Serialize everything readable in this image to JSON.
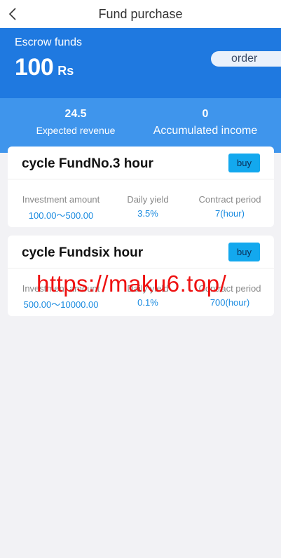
{
  "header": {
    "title": "Fund purchase"
  },
  "hero": {
    "label": "Escrow funds",
    "amount": "100",
    "currency": "Rs",
    "order_label": "order"
  },
  "stats": [
    {
      "value": "24.5",
      "label": "Expected revenue"
    },
    {
      "value": "0",
      "label": "Accumulated income"
    }
  ],
  "funds": [
    {
      "title": "cycle FundNo.3 hour",
      "buy_label": "buy",
      "columns": [
        {
          "label": "Investment amount",
          "value": "100.00～500.00"
        },
        {
          "label": "Daily yield",
          "value": "3.5%"
        },
        {
          "label": "Contract period",
          "value": "7(hour)"
        }
      ]
    },
    {
      "title": "cycle Fundsix hour",
      "buy_label": "buy",
      "columns": [
        {
          "label": "Investment amount",
          "value": "500.00～10000.00"
        },
        {
          "label": "Daily yield",
          "value": "0.1%"
        },
        {
          "label": "Contract period",
          "value": "700(hour)"
        }
      ]
    }
  ],
  "watermark": "https://maku6.top/",
  "colors": {
    "hero_bg": "#1f79e0",
    "stats_bg": "#3f95ec",
    "buy_bg": "#13a8ee",
    "value_text": "#1a8be0",
    "watermark": "#ee1111"
  },
  "icons": {
    "back": "chevron-left-icon"
  }
}
